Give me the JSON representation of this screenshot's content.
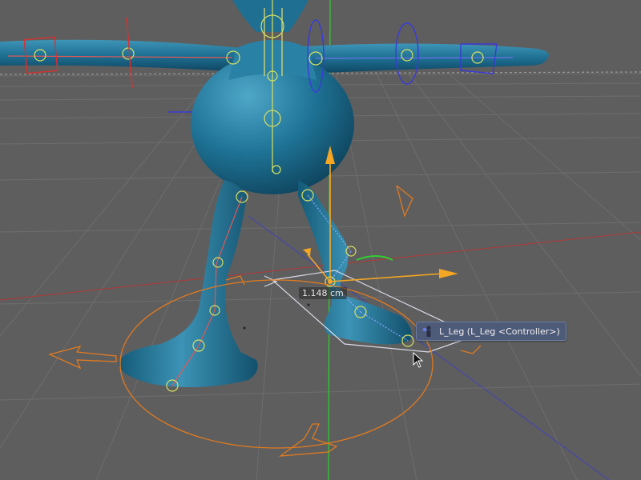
{
  "viewport": {
    "measure_label": "1.148 cm",
    "hover_tooltip": {
      "text": "L_Leg (L_Leg <Controller>)",
      "icon": "character-joint-icon"
    },
    "colors": {
      "background": "#5e5e5e",
      "character_mesh": "#1d6f92",
      "axis_y": "#2fd02f",
      "axis_z": "#3a3ad0",
      "axis_x": "#d03030",
      "manipulator": "#f5a623",
      "controller": "#e07a20",
      "joints": "#d8e060",
      "tooltip_bg": "#4d5a78"
    }
  }
}
